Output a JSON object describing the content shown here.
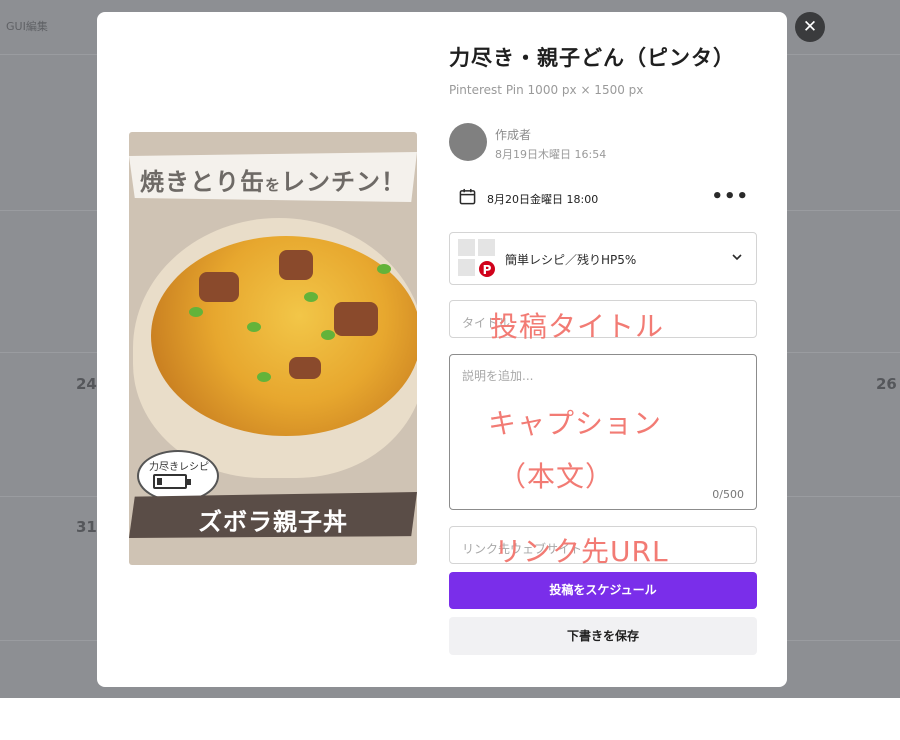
{
  "background": {
    "corner_label": "GUI編集",
    "calendar_numbers": [
      "24",
      "26",
      "31"
    ]
  },
  "close_icon": "close-icon",
  "modal": {
    "title": "力尽き・親子どん（ピンタ）",
    "subtitle": "Pinterest Pin 1000 px × 1500 px",
    "pin_image": {
      "top_text_main": "焼きとり缶",
      "top_text_small": "を",
      "top_text_end": "レンチン！",
      "bubble_text": "力尽きレシピ",
      "bottom_text": "ズボラ親子丼"
    },
    "author": {
      "label": "作成者",
      "date": "8月19日木曜日 16:54"
    },
    "schedule": {
      "date_time": "8月20日金曜日 18:00",
      "icon": "calendar-icon",
      "more_icon": "more-horizontal-icon"
    },
    "board": {
      "name": "簡単レシピ／残りHP5%",
      "icon": "pinterest-icon",
      "pin_glyph": "P"
    },
    "fields": {
      "title_placeholder": "タイトル",
      "description_placeholder": "説明を追加...",
      "description_counter": "0/500",
      "link_placeholder": "リンク先ウェブサイト"
    },
    "buttons": {
      "schedule": "投稿をスケジュール",
      "save_draft": "下書きを保存"
    }
  },
  "annotations": {
    "title": "投稿タイトル",
    "caption_line1": "キャプション",
    "caption_line2": "（本文）",
    "link": "リンク先URL",
    "color": "#f27b74"
  },
  "colors": {
    "primary": "#7a2eea",
    "pinterest": "#d0021b"
  }
}
